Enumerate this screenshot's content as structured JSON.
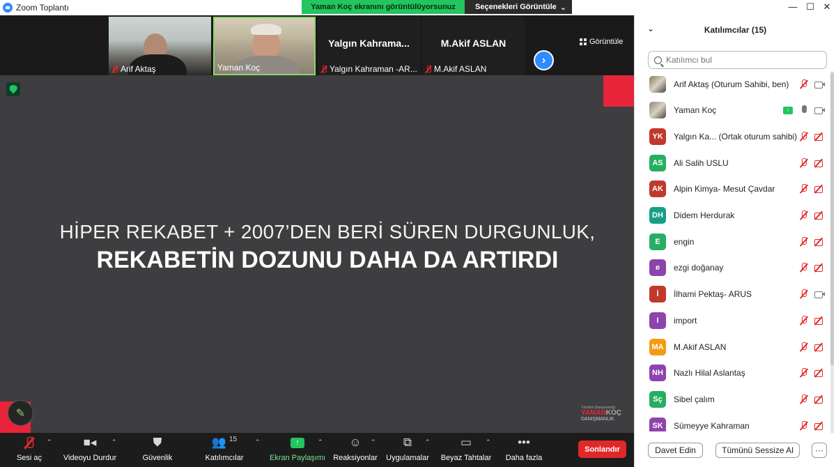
{
  "window": {
    "title": "Zoom Toplantı"
  },
  "share_banner": {
    "text": "Yaman Koç  ekranını görüntülüyorsunuz",
    "view_options": "Seçenekleri Görüntüle"
  },
  "strip": {
    "tiles": [
      {
        "name": "Arif Aktaş",
        "type": "video"
      },
      {
        "name": "Yaman Koç",
        "type": "video"
      },
      {
        "center_name": "Yalgın  Kahrama...",
        "name": "Yalgın Kahraman -AR..."
      },
      {
        "center_name": "M.Akif ASLAN",
        "name": "M.Akif ASLAN"
      }
    ],
    "view_label": "Görüntüle"
  },
  "slide": {
    "line1": "HİPER REKABET + 2007’DEN BERİ SÜREN DURGUNLUK,",
    "line2": "REKABETİN DOZUNU DAHA DA ARTIRDI",
    "logo": {
      "small": "Yönetim Danışmanlığı",
      "brand_a": "YAMAN",
      "brand_b": "KOÇ",
      "sub": "DANIŞMANLIK"
    }
  },
  "toolbar": {
    "unmute": "Sesi aç",
    "stop_video": "Videoyu Durdur",
    "security": "Güvenlik",
    "participants": "Katılımcılar",
    "participants_count": "15",
    "share": "Ekran Paylaşımı",
    "reactions": "Reaksiyonlar",
    "apps": "Uygulamalar",
    "whiteboard": "Beyaz Tahtalar",
    "more": "Daha fazla",
    "end": "Sonlandır"
  },
  "panel": {
    "title": "Katılımcılar (15)",
    "search_placeholder": "Katılımcı bul",
    "participants": [
      {
        "name": "Arif Aktaş (Oturum Sahibi, ben)",
        "avatar": "",
        "color": "#8a7a5c",
        "photo": true,
        "mic": "muted",
        "cam": "on"
      },
      {
        "name": "Yaman Koç",
        "avatar": "",
        "color": "#8c8577",
        "photo": true,
        "mic": "on",
        "cam": "on",
        "sharing": true
      },
      {
        "name": "Yalgın Ka... (Ortak oturum sahibi)",
        "avatar": "YK",
        "color": "#c0392b",
        "mic": "muted",
        "cam": "off"
      },
      {
        "name": "Ali Salih USLU",
        "avatar": "AS",
        "color": "#27ae60",
        "mic": "muted",
        "cam": "off"
      },
      {
        "name": "Alpin Kimya- Mesut Çavdar",
        "avatar": "AK",
        "color": "#c0392b",
        "mic": "muted",
        "cam": "off"
      },
      {
        "name": "Didem Herdurak",
        "avatar": "DH",
        "color": "#16a085",
        "mic": "muted",
        "cam": "off"
      },
      {
        "name": "engin",
        "avatar": "E",
        "color": "#27ae60",
        "mic": "muted",
        "cam": "off"
      },
      {
        "name": "ezgi doğanay",
        "avatar": "e",
        "color": "#8e44ad",
        "mic": "muted",
        "cam": "off"
      },
      {
        "name": "İlhami Pektaş- ARUS",
        "avatar": "İ",
        "color": "#c0392b",
        "mic": "muted",
        "cam": "on"
      },
      {
        "name": "import",
        "avatar": "I",
        "color": "#8e44ad",
        "mic": "muted",
        "cam": "off"
      },
      {
        "name": "M.Akif ASLAN",
        "avatar": "MA",
        "color": "#f39c12",
        "mic": "muted",
        "cam": "off"
      },
      {
        "name": "Nazlı Hilal Aslantaş",
        "avatar": "NH",
        "color": "#8e44ad",
        "mic": "muted",
        "cam": "off"
      },
      {
        "name": "Sibel çalım",
        "avatar": "Sç",
        "color": "#27ae60",
        "mic": "muted",
        "cam": "off"
      },
      {
        "name": "Sümeyye Kahraman",
        "avatar": "SK",
        "color": "#8e44ad",
        "mic": "muted",
        "cam": "off"
      }
    ],
    "invite": "Davet Edin",
    "mute_all": "Tümünü Sessize Al",
    "more": "···"
  }
}
